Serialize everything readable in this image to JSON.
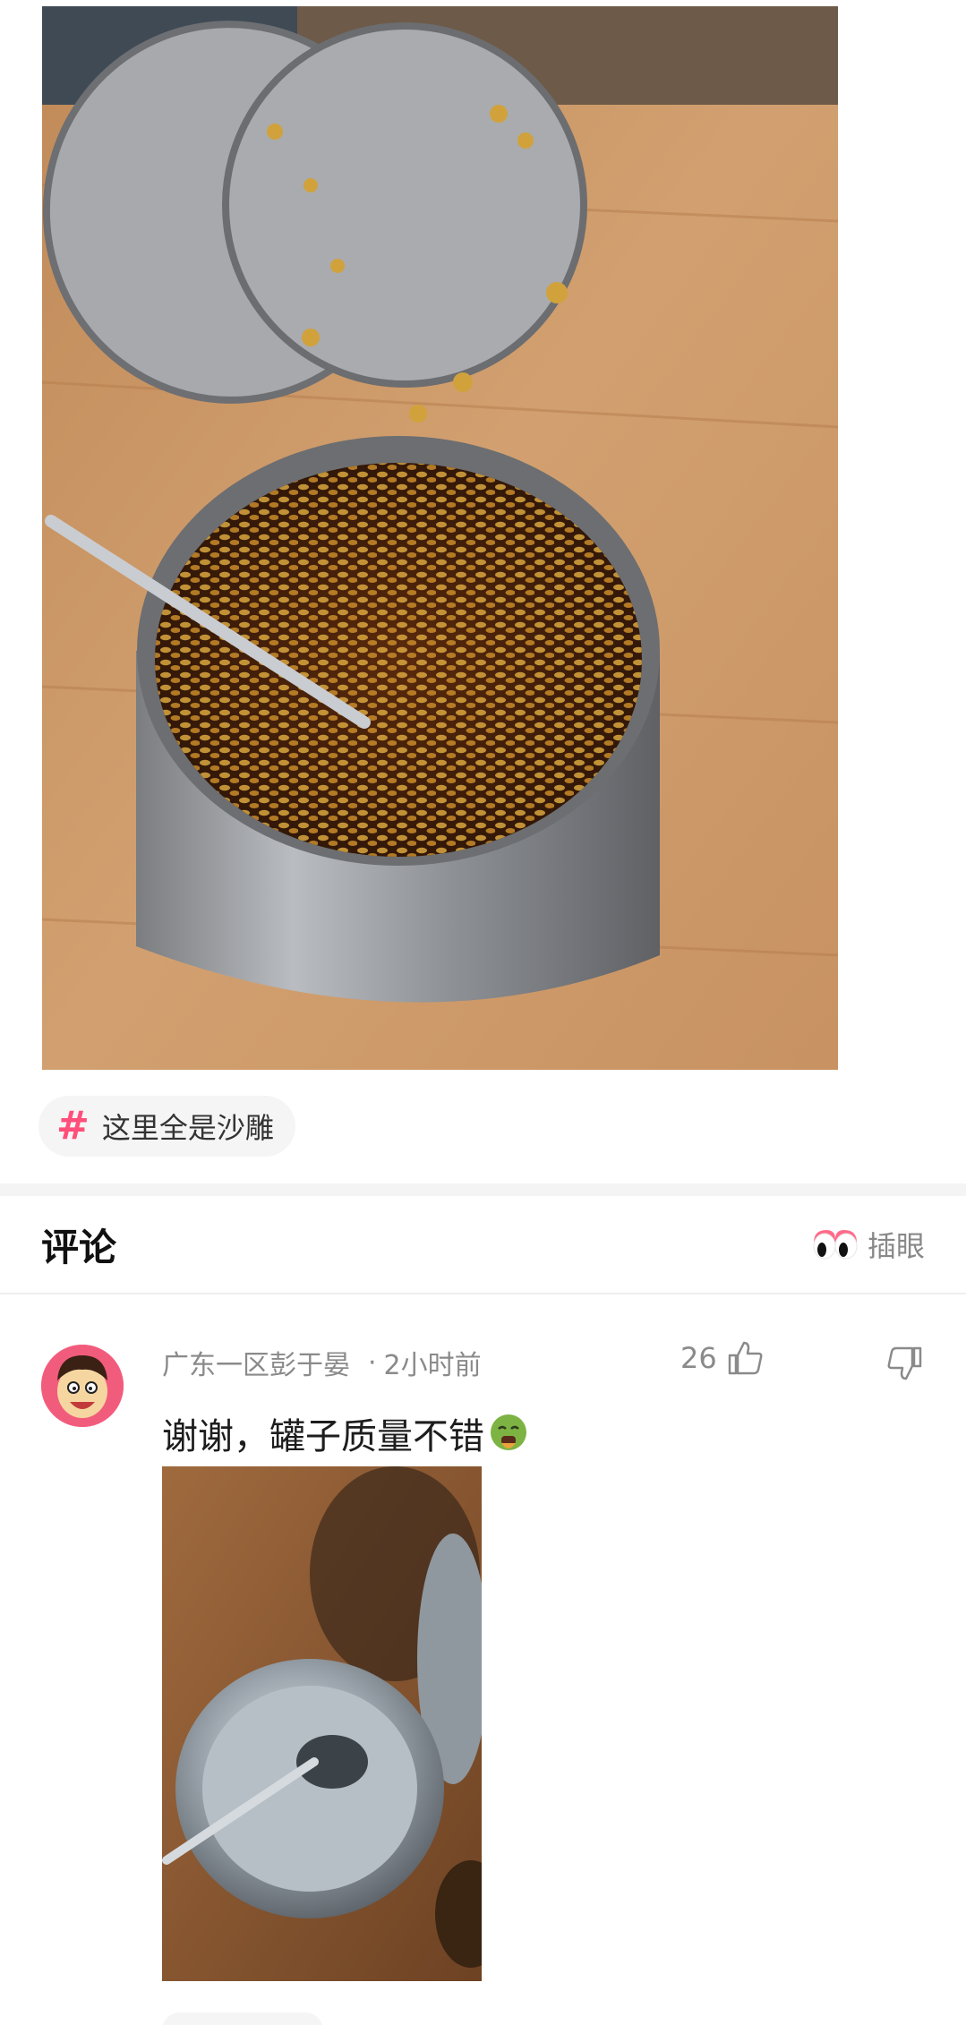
{
  "post": {
    "image_alt": "",
    "topic_tag": {
      "hash_symbol": "#",
      "label": "这里全是沙雕"
    }
  },
  "comments_section": {
    "title": "评论",
    "poke_label": "插眼"
  },
  "comments": [
    {
      "username": "广东一区彭于晏",
      "separator": "·",
      "time": "2小时前",
      "likes": "26",
      "text": "谢谢，罐子质量不错",
      "emoji": "🤮"
    }
  ],
  "colors": {
    "accent_pink": "#ff4f7a",
    "text_gray": "#8a8a8a"
  },
  "icons": [
    "hash-icon",
    "poke-eyes-icon",
    "thumb-up-icon",
    "thumb-down-icon",
    "vomit-emoji-icon",
    "avatar-icon"
  ]
}
